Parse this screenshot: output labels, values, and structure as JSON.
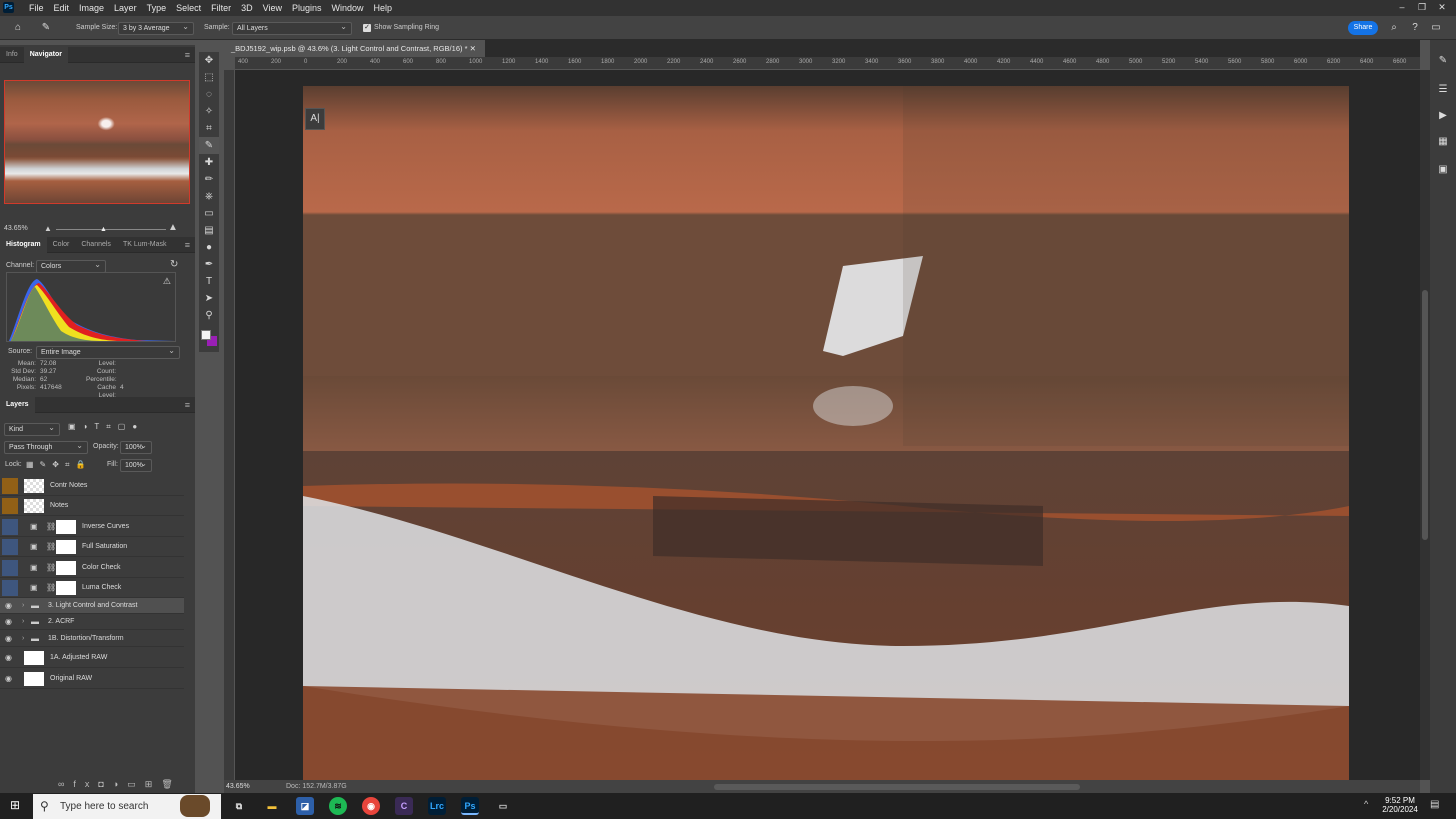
{
  "app": {
    "icon_text": "Ps",
    "menus": [
      "File",
      "Edit",
      "Image",
      "Layer",
      "Type",
      "Select",
      "Filter",
      "3D",
      "View",
      "Plugins",
      "Window",
      "Help"
    ],
    "window_controls": [
      "–",
      "❐",
      "✕"
    ]
  },
  "options": {
    "sample_size_label": "Sample Size:",
    "sample_size_value": "3 by 3 Average",
    "sample_label": "Sample:",
    "sample_value": "All Layers",
    "sampling_ring_label": "Show Sampling Ring",
    "share_label": "Share"
  },
  "panels": {
    "nav_tabs": [
      "Info",
      "Navigator"
    ],
    "zoom": "43.65%",
    "hist_tabs": [
      "Histogram",
      "Color",
      "Channels",
      "TK Lum-Mask"
    ],
    "channel_label": "Channel:",
    "channel_value": "Colors",
    "source_label": "Source:",
    "source_value": "Entire Image",
    "stats_left": [
      [
        "Mean:",
        "72.08"
      ],
      [
        "Std Dev:",
        "39.27"
      ],
      [
        "Median:",
        "62"
      ],
      [
        "Pixels:",
        "417648"
      ]
    ],
    "stats_right": [
      [
        "Level:",
        ""
      ],
      [
        "Count:",
        ""
      ],
      [
        "Percentile:",
        ""
      ],
      [
        "Cache Level:",
        "4"
      ]
    ]
  },
  "layers": {
    "title": "Layers",
    "filter_value": "Kind",
    "blend_mode": "Pass Through",
    "opacity_label": "Opacity:",
    "opacity_value": "100%",
    "lock_label": "Lock:",
    "fill_label": "Fill:",
    "fill_value": "100%",
    "items": [
      {
        "name": "Contr Notes",
        "color": "#a0660f",
        "visible": false,
        "kind": "checker"
      },
      {
        "name": "Notes",
        "color": "#a0660f",
        "visible": false,
        "kind": "checker"
      },
      {
        "name": "Inverse Curves",
        "color": "#3e5a8a",
        "visible": false,
        "kind": "adjust"
      },
      {
        "name": "Full Saturation",
        "color": "#3e5a8a",
        "visible": false,
        "kind": "adjust"
      },
      {
        "name": "Color Check",
        "color": "#3e5a8a",
        "visible": false,
        "kind": "adjust"
      },
      {
        "name": "Luma Check",
        "color": "#3e5a8a",
        "visible": false,
        "kind": "adjust"
      },
      {
        "name": "3. Light Control and Contrast",
        "color": "",
        "visible": true,
        "kind": "group"
      },
      {
        "name": "2. ACRF",
        "color": "",
        "visible": true,
        "kind": "group"
      },
      {
        "name": "1B. Distortion/Transform",
        "color": "",
        "visible": true,
        "kind": "group"
      },
      {
        "name": "1A. Adjusted RAW",
        "color": "",
        "visible": true,
        "kind": "image"
      },
      {
        "name": "Original RAW",
        "color": "",
        "visible": true,
        "kind": "image"
      }
    ]
  },
  "document": {
    "tab_title": "_BDJ5192_wip.psb @ 43.6% (3. Light Control and Contrast, RGB/16) *",
    "ruler_ticks": [
      "400",
      "200",
      "0",
      "200",
      "400",
      "600",
      "800",
      "1000",
      "1200",
      "1400",
      "1600",
      "1800",
      "2000",
      "2200",
      "2400",
      "2600",
      "2800",
      "3000",
      "3200",
      "3400",
      "3600",
      "3800",
      "4000",
      "4200",
      "4400",
      "4600",
      "4800",
      "5000",
      "5200",
      "5400",
      "5600",
      "5800",
      "6000",
      "6200",
      "6400",
      "6600"
    ],
    "status_zoom": "43.65%",
    "status_doc": "Doc: 152.7M/3.87G"
  },
  "taskbar": {
    "search_placeholder": "Type here to search",
    "time": "9:52 PM",
    "date": "2/20/2024",
    "apps": [
      "Lrc",
      "Ps"
    ]
  }
}
